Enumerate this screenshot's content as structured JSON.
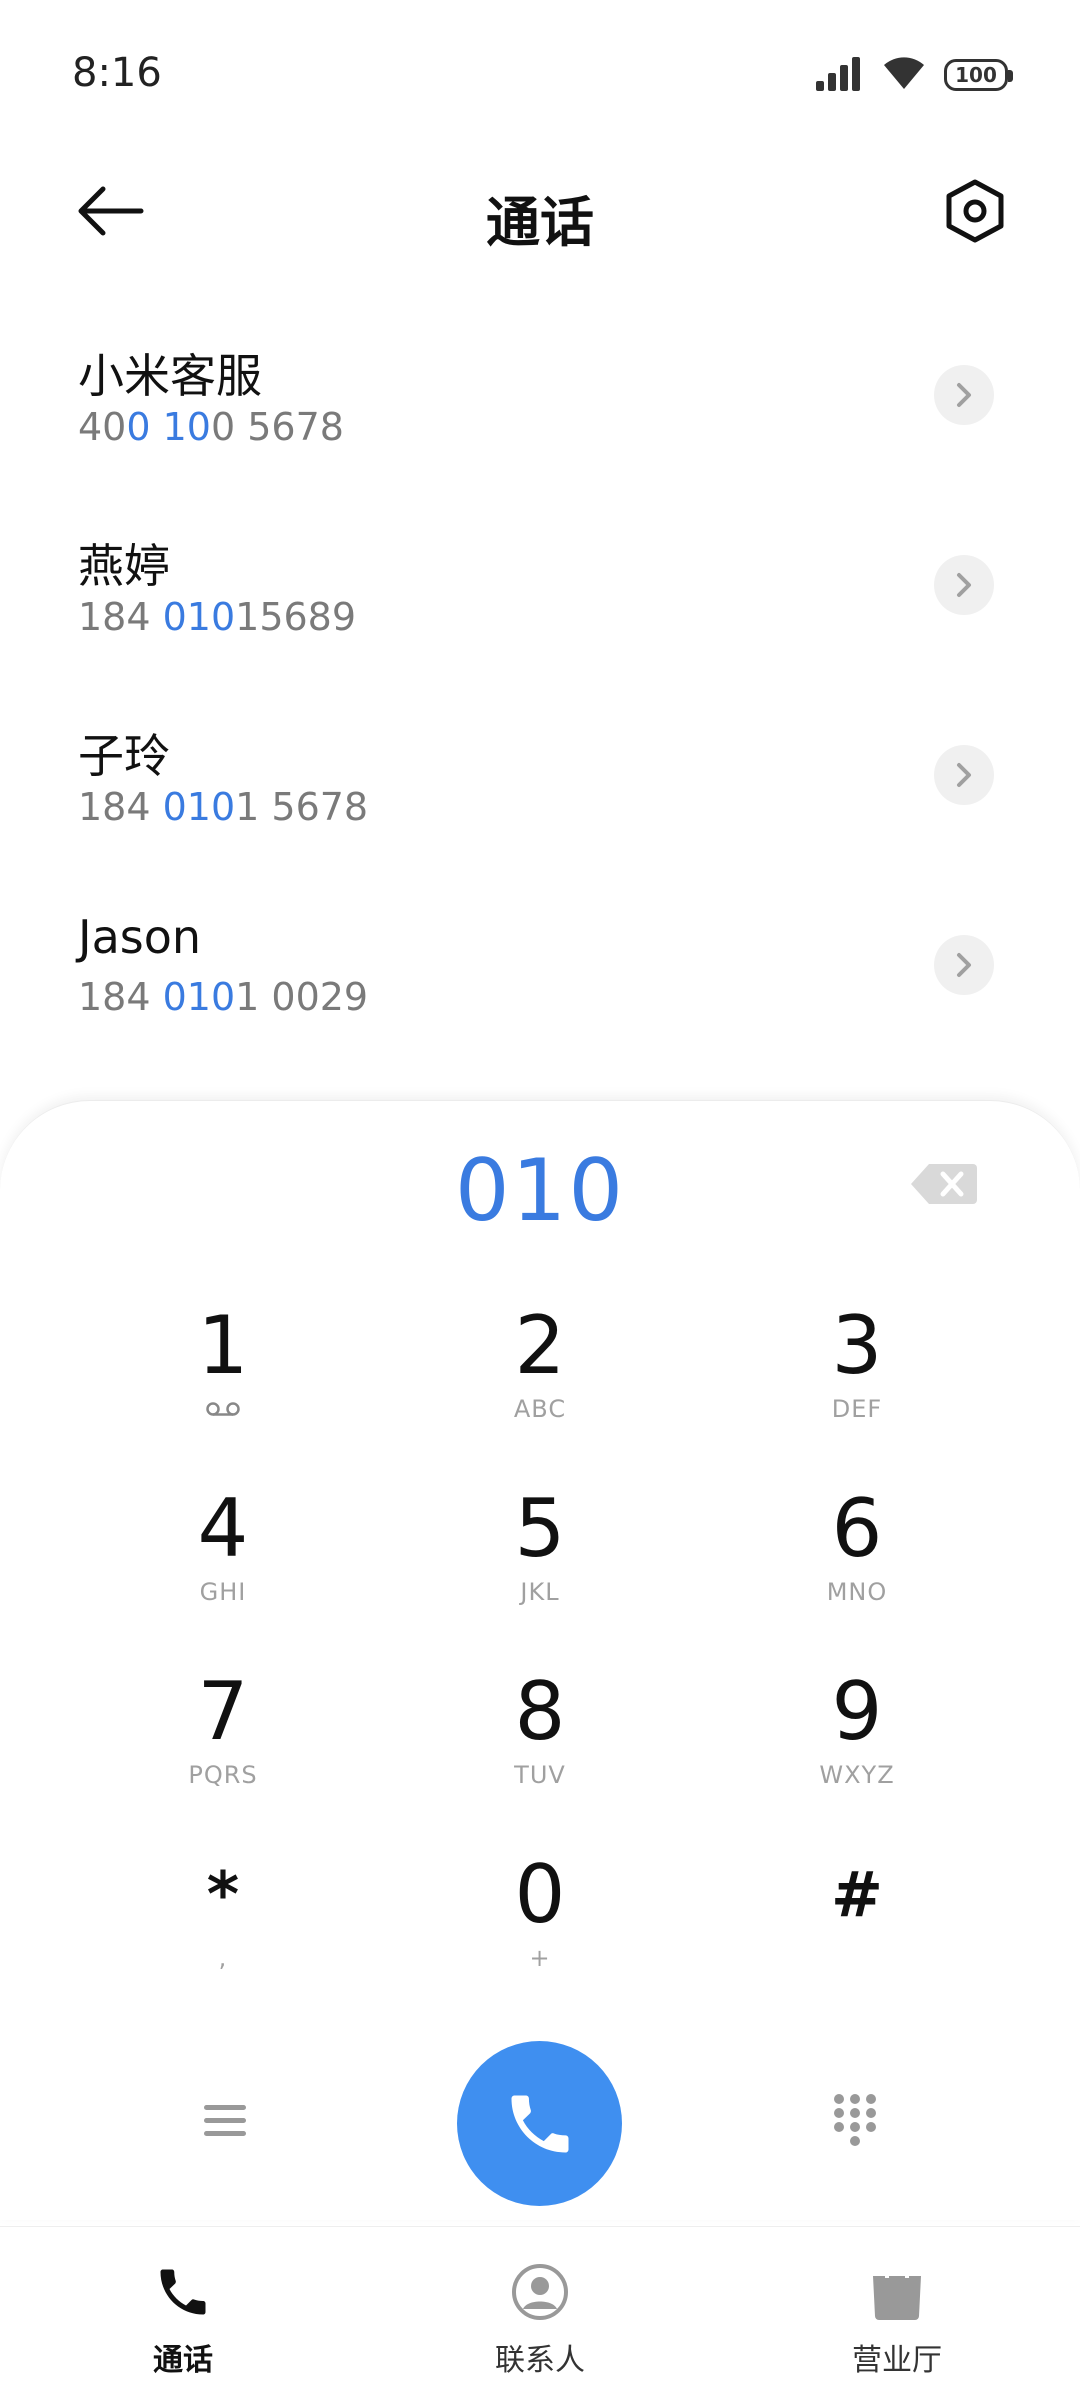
{
  "status_bar": {
    "time": "8:16",
    "battery": "100"
  },
  "header": {
    "title": "通话"
  },
  "results": [
    {
      "name": "小米客服",
      "number_parts": [
        {
          "text": "40",
          "hl": false
        },
        {
          "text": "0 10",
          "hl": true
        },
        {
          "text": "0 5678",
          "hl": false
        }
      ]
    },
    {
      "name": "燕婷",
      "number_parts": [
        {
          "text": "184 ",
          "hl": false
        },
        {
          "text": "010",
          "hl": true
        },
        {
          "text": "15689",
          "hl": false
        }
      ]
    },
    {
      "name": "子玲",
      "number_parts": [
        {
          "text": "184 ",
          "hl": false
        },
        {
          "text": "010",
          "hl": true
        },
        {
          "text": "1 5678",
          "hl": false
        }
      ]
    },
    {
      "name": "Jason",
      "number_parts": [
        {
          "text": "184 ",
          "hl": false
        },
        {
          "text": "010",
          "hl": true
        },
        {
          "text": "1 0029",
          "hl": false
        }
      ]
    }
  ],
  "dialer": {
    "display": "010",
    "keys": [
      {
        "digit": "1",
        "letters": "voicemail"
      },
      {
        "digit": "2",
        "letters": "ABC"
      },
      {
        "digit": "3",
        "letters": "DEF"
      },
      {
        "digit": "4",
        "letters": "GHI"
      },
      {
        "digit": "5",
        "letters": "JKL"
      },
      {
        "digit": "6",
        "letters": "MNO"
      },
      {
        "digit": "7",
        "letters": "PQRS"
      },
      {
        "digit": "8",
        "letters": "TUV"
      },
      {
        "digit": "9",
        "letters": "WXYZ"
      },
      {
        "digit": "*",
        "letters": ","
      },
      {
        "digit": "0",
        "letters": "+"
      },
      {
        "digit": "#",
        "letters": ""
      }
    ]
  },
  "nav": [
    {
      "label": "通话",
      "icon": "phone-icon",
      "active": true
    },
    {
      "label": "联系人",
      "icon": "contact-icon",
      "active": false
    },
    {
      "label": "营业厅",
      "icon": "shopping-bag-icon",
      "active": false
    }
  ],
  "colors": {
    "accent": "#3a7be0",
    "call_button": "#3f8ff0"
  }
}
